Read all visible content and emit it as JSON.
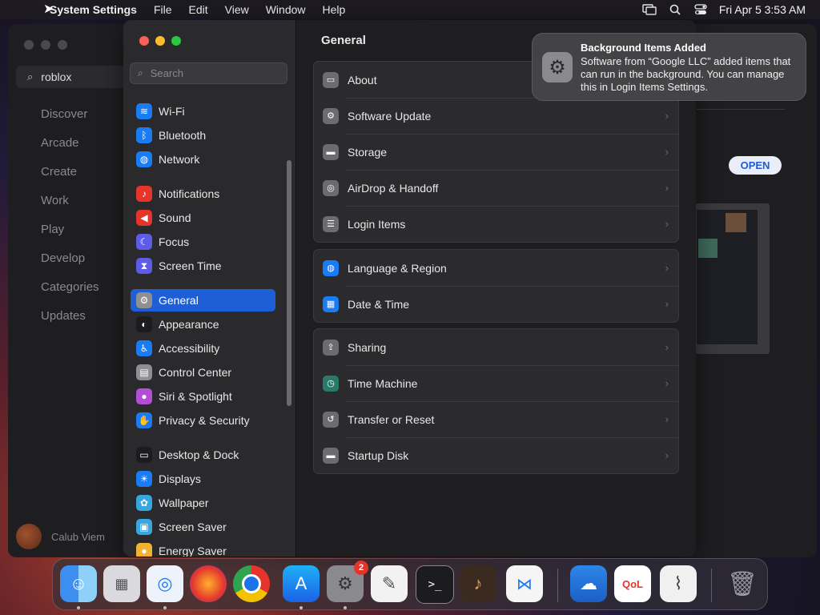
{
  "menubar": {
    "app_name": "System Settings",
    "menus": [
      "File",
      "Edit",
      "View",
      "Window",
      "Help"
    ],
    "datetime": "Fri Apr 5  3:53 AM"
  },
  "background_app": {
    "search_value": "roblox",
    "nav": [
      "Discover",
      "Arcade",
      "Create",
      "Work",
      "Play",
      "Develop",
      "Categories",
      "Updates"
    ],
    "user_name": "Calub Viem",
    "open_button": "OPEN"
  },
  "settings": {
    "search_placeholder": "Search",
    "sidebar": [
      {
        "label": "Wi-Fi",
        "icon": "wifi-icon",
        "color": "#1a7cf5"
      },
      {
        "label": "Bluetooth",
        "icon": "bluetooth-icon",
        "color": "#1a7cf5"
      },
      {
        "label": "Network",
        "icon": "globe-icon",
        "color": "#1a7cf5"
      },
      {
        "label": "Notifications",
        "icon": "bell-icon",
        "color": "#e5352b"
      },
      {
        "label": "Sound",
        "icon": "speaker-icon",
        "color": "#e5352b"
      },
      {
        "label": "Focus",
        "icon": "moon-icon",
        "color": "#5e5ce6"
      },
      {
        "label": "Screen Time",
        "icon": "hourglass-icon",
        "color": "#5e5ce6"
      },
      {
        "label": "General",
        "icon": "gear-icon",
        "color": "#8e8e93"
      },
      {
        "label": "Appearance",
        "icon": "appearance-icon",
        "color": "#1c1c1e"
      },
      {
        "label": "Accessibility",
        "icon": "accessibility-icon",
        "color": "#1a7cf5"
      },
      {
        "label": "Control Center",
        "icon": "control-center-icon",
        "color": "#8e8e93"
      },
      {
        "label": "Siri & Spotlight",
        "icon": "siri-icon",
        "color": "#b34fd6"
      },
      {
        "label": "Privacy & Security",
        "icon": "hand-icon",
        "color": "#1a7cf5"
      },
      {
        "label": "Desktop & Dock",
        "icon": "dock-icon",
        "color": "#1c1c1e"
      },
      {
        "label": "Displays",
        "icon": "sun-icon",
        "color": "#1a7cf5"
      },
      {
        "label": "Wallpaper",
        "icon": "flower-icon",
        "color": "#36a7e0"
      },
      {
        "label": "Screen Saver",
        "icon": "screensaver-icon",
        "color": "#36a7e0"
      },
      {
        "label": "Energy Saver",
        "icon": "bulb-icon",
        "color": "#f2b233"
      }
    ],
    "content_title": "General",
    "groups": [
      [
        {
          "label": "About",
          "icon": "laptop-icon"
        },
        {
          "label": "Software Update",
          "icon": "gear-icon"
        },
        {
          "label": "Storage",
          "icon": "drive-icon"
        },
        {
          "label": "AirDrop & Handoff",
          "icon": "airdrop-icon"
        },
        {
          "label": "Login Items",
          "icon": "list-icon"
        }
      ],
      [
        {
          "label": "Language & Region",
          "icon": "globe-icon"
        },
        {
          "label": "Date & Time",
          "icon": "calendar-icon"
        }
      ],
      [
        {
          "label": "Sharing",
          "icon": "share-icon"
        },
        {
          "label": "Time Machine",
          "icon": "time-machine-icon"
        },
        {
          "label": "Transfer or Reset",
          "icon": "reset-icon"
        },
        {
          "label": "Startup Disk",
          "icon": "disk-icon"
        }
      ]
    ]
  },
  "notification": {
    "title": "Background Items Added",
    "body": "Software from “Google LLC” added items that can run in the background. You can manage this in Login Items Settings."
  },
  "dock": {
    "settings_badge": "2"
  }
}
